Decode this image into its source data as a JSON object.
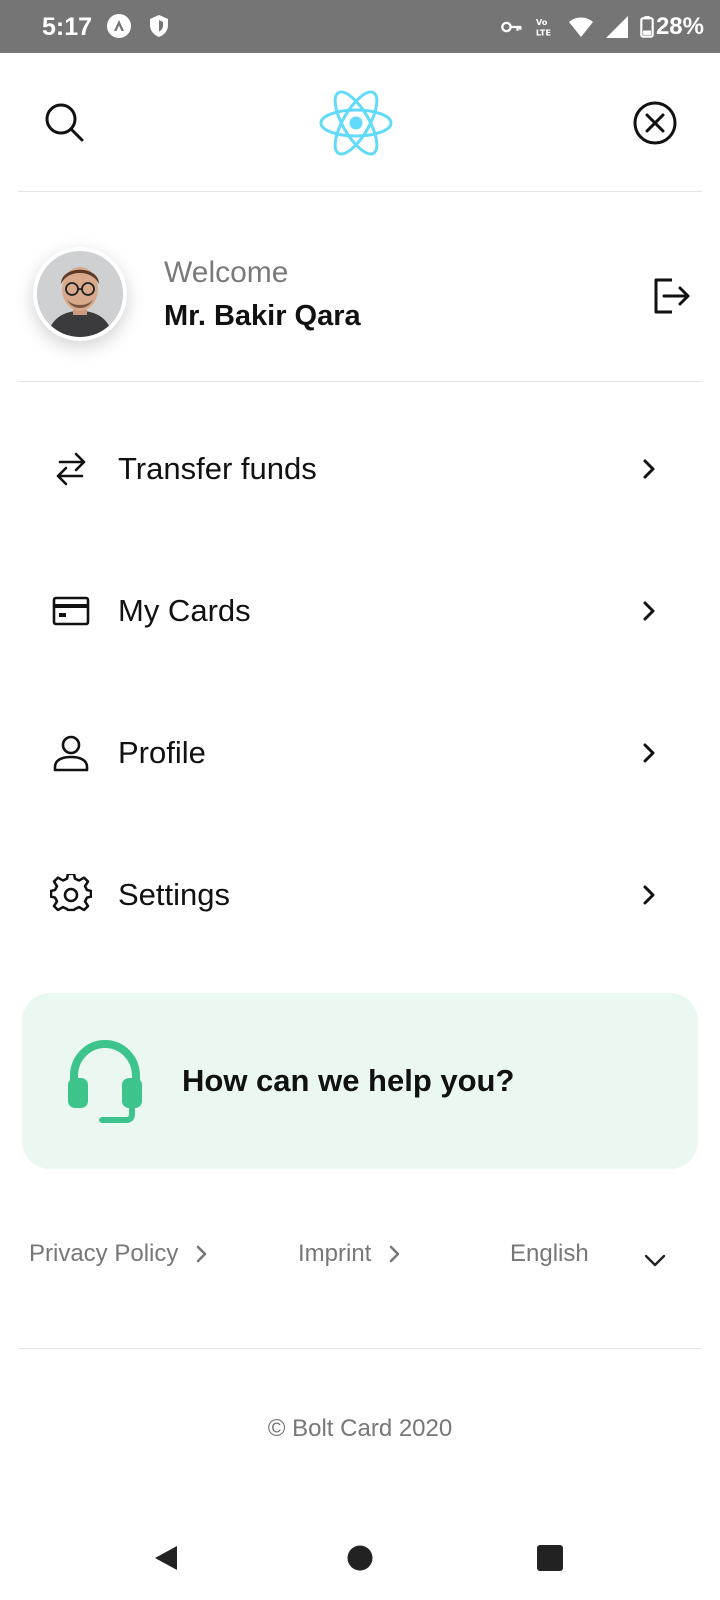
{
  "status_bar": {
    "time": "5:17",
    "battery_percent": "28%",
    "icons": [
      "android-auto-icon",
      "shield-icon",
      "vpn-key-icon",
      "volte-icon",
      "wifi-icon",
      "signal-icon",
      "battery-icon"
    ]
  },
  "header": {
    "search_icon": "search-icon",
    "logo_icon": "react-logo-icon",
    "close_icon": "close-circle-icon",
    "logo_color": "#61dafb"
  },
  "user": {
    "greeting": "Welcome",
    "name": "Mr. Bakir Qara",
    "logout_icon": "logout-icon"
  },
  "menu": {
    "items": [
      {
        "label": "Transfer funds",
        "icon": "transfer-icon"
      },
      {
        "label": "My Cards",
        "icon": "credit-card-icon"
      },
      {
        "label": "Profile",
        "icon": "user-icon"
      },
      {
        "label": "Settings",
        "icon": "gear-icon"
      }
    ]
  },
  "help": {
    "text": "How can we help you?",
    "icon": "headset-icon",
    "accent_color": "#3dc48d",
    "background_color": "#ebf8f2"
  },
  "footer": {
    "privacy": "Privacy Policy",
    "imprint": "Imprint",
    "language": "English",
    "copyright": "© Bolt Card 2020"
  },
  "nav_bar": {
    "back_icon": "back-triangle-icon",
    "home_icon": "home-circle-icon",
    "recents_icon": "recents-square-icon"
  }
}
